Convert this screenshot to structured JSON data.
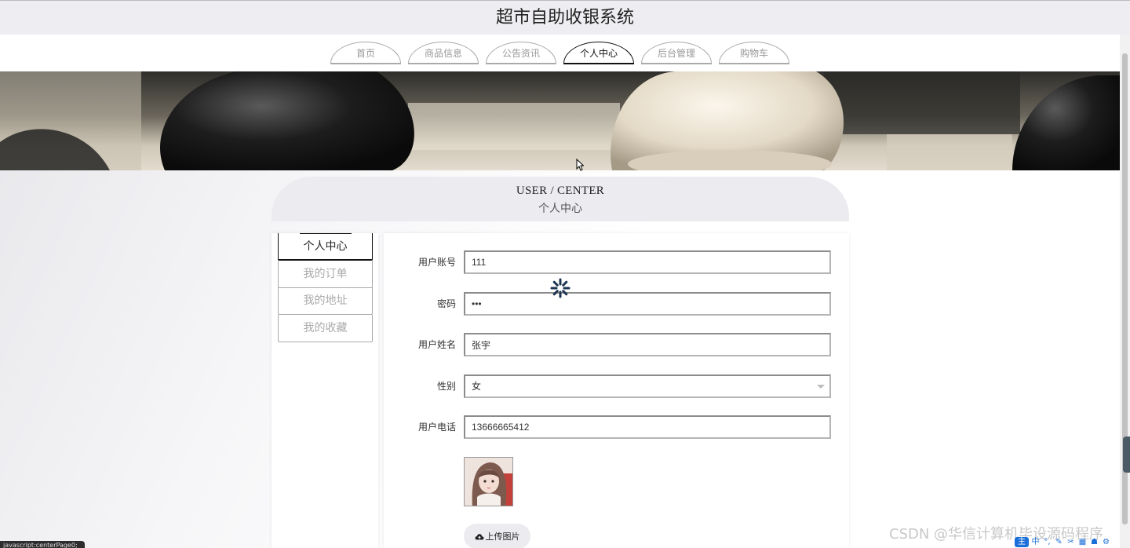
{
  "site": {
    "title": "超市自助收银系统"
  },
  "nav": {
    "items": [
      {
        "label": "首页",
        "active": false
      },
      {
        "label": "商品信息",
        "active": false
      },
      {
        "label": "公告资讯",
        "active": false
      },
      {
        "label": "个人中心",
        "active": true
      },
      {
        "label": "后台管理",
        "active": false
      },
      {
        "label": "购物车",
        "active": false
      }
    ]
  },
  "section": {
    "title_en": "USER / CENTER",
    "title_zh": "个人中心"
  },
  "sidebar": {
    "items": [
      {
        "label": "个人中心",
        "active": true
      },
      {
        "label": "我的订单",
        "active": false
      },
      {
        "label": "我的地址",
        "active": false
      },
      {
        "label": "我的收藏",
        "active": false
      }
    ]
  },
  "form": {
    "account": {
      "label": "用户账号",
      "value": "111"
    },
    "password": {
      "label": "密码",
      "value": "•••"
    },
    "name": {
      "label": "用户姓名",
      "value": "张宇"
    },
    "gender": {
      "label": "性别",
      "value": "女"
    },
    "phone": {
      "label": "用户电话",
      "value": "13666665412"
    },
    "upload_label": "上传图片"
  },
  "status_bar": {
    "text": "javascript:centerPage0;"
  },
  "watermark": {
    "text": "CSDN @华信计算机毕设源码程序"
  },
  "ime": {
    "items": [
      "主",
      "中",
      "°,",
      "✎",
      "✂",
      "▦",
      "☗",
      "⚙"
    ]
  },
  "colors": {
    "accent": "#111111",
    "muted": "#aaaaaa",
    "header_bg": "#eeeef2",
    "ime_blue": "#1a6fd8"
  },
  "icons": {
    "spinner": "loading-spinner-icon",
    "upload": "cloud-upload-icon",
    "cursor": "mouse-cursor-icon"
  }
}
